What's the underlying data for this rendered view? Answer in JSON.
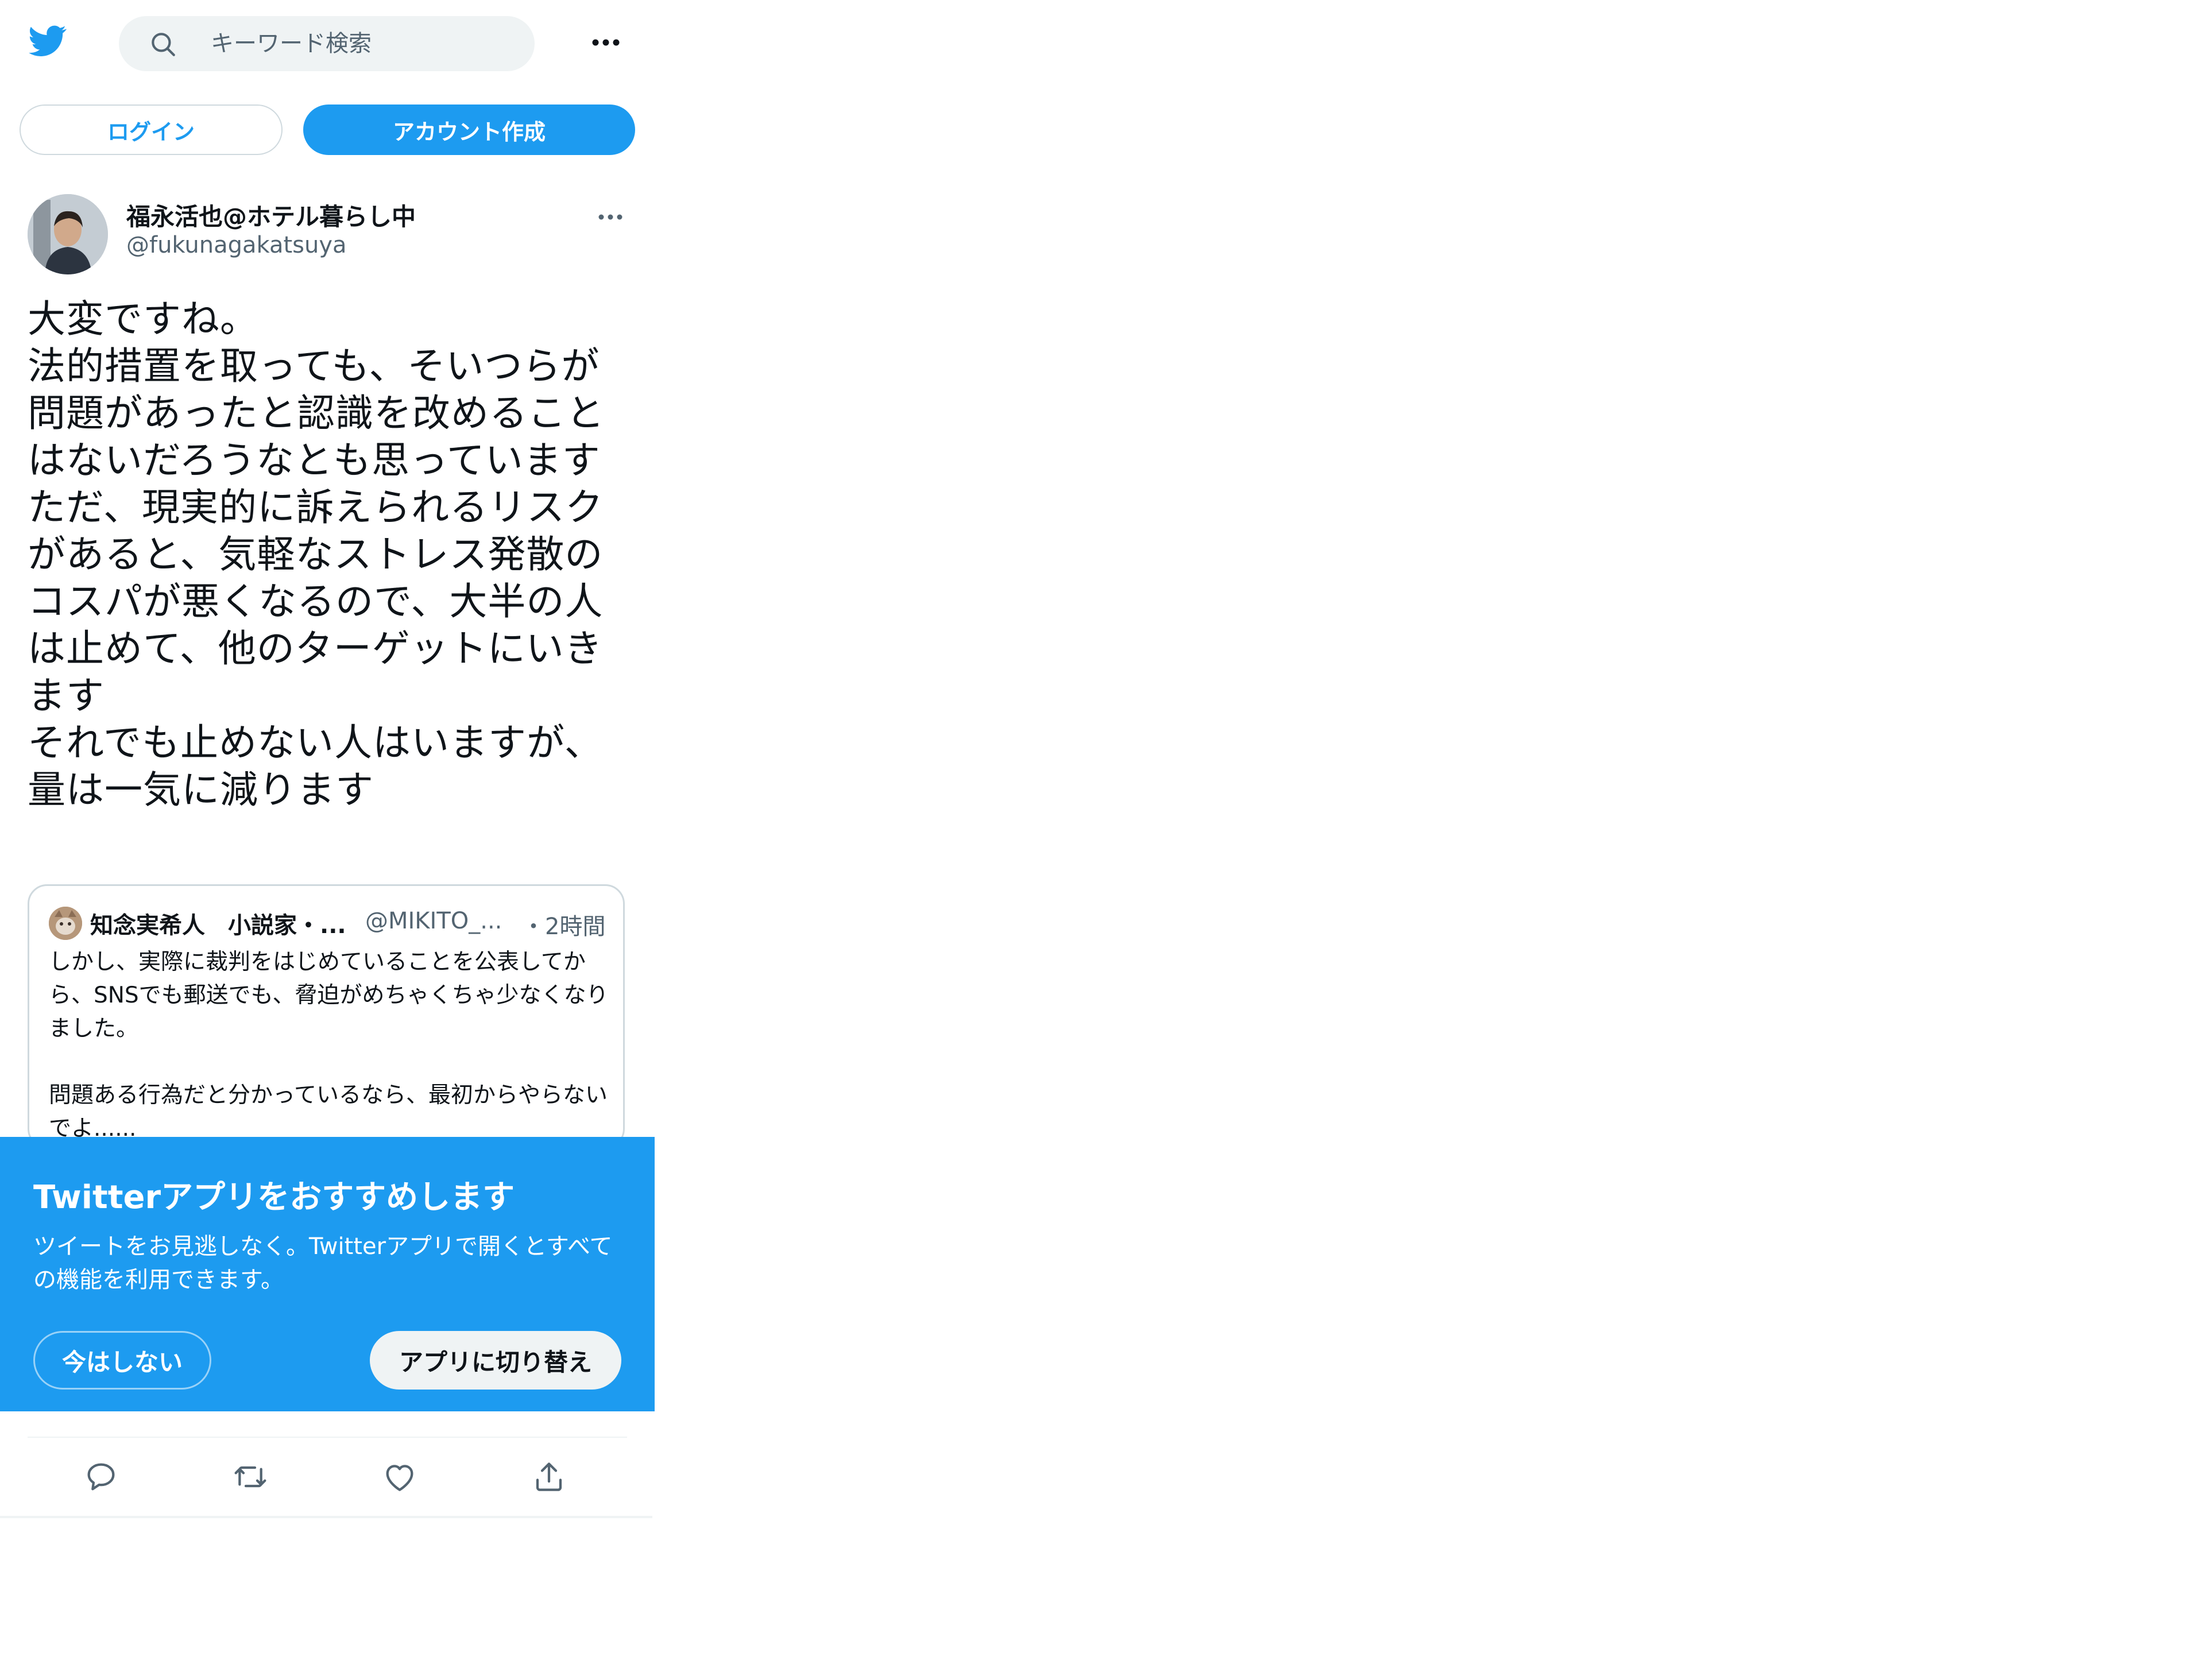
{
  "header": {
    "logo_icon": "twitter-bird-icon",
    "search_placeholder": "キーワード検索",
    "more_icon": "more-horizontal-icon",
    "accent_color": "#1d9bf0"
  },
  "auth": {
    "login_label": "ログイン",
    "signup_label": "アカウント作成"
  },
  "tweet": {
    "author_name": "福永活也@ホテル暮らし中",
    "author_handle": "@fukunagakatsuya",
    "text": "大変ですね。\n法的措置を取っても、そいつらが問題があったと認識を改めることはないだろうなとも思っています\nただ、現実的に訴えられるリスクがあると、気軽なストレス発散のコスパが悪くなるので、大半の人は止めて、他のターゲットにいきます\nそれでも止めない人はいますが、量は一気に減ります"
  },
  "quoted_tweet": {
    "author_name": "知念実希人　小説家・...",
    "author_handle": "@MIKITO_...",
    "time": "・2時間",
    "text": "しかし、実際に裁判をはじめていることを公表してから、SNSでも郵送でも、脅迫がめちゃくちゃ少なくなりました。\n\n問題ある行為だと分かっているなら、最初からやらないでよ......"
  },
  "app_banner": {
    "title": "Twitterアプリをおすすめします",
    "body": "ツイートをお見逃しなく。Twitterアプリで開くとすべての機能を利用できます。",
    "not_now_label": "今はしない",
    "switch_label": "アプリに切り替え",
    "background_color": "#1d9bf0"
  },
  "actions": {
    "icons": [
      "reply-icon",
      "retweet-icon",
      "like-icon",
      "share-icon"
    ]
  }
}
